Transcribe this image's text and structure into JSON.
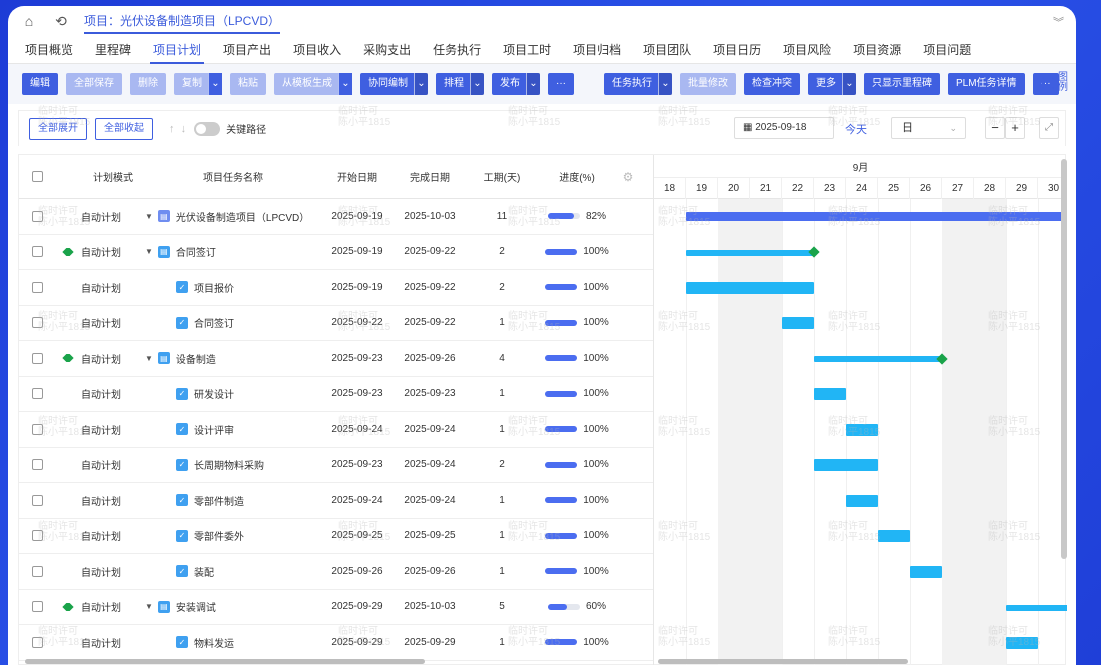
{
  "titlebar": {
    "home_icon": "home-icon",
    "back_icon": "history-icon",
    "title": "项目：光伏设备制造项目（LPCVD）"
  },
  "nav_tabs": [
    "项目概览",
    "里程碑",
    "项目计划",
    "项目产出",
    "项目收入",
    "采购支出",
    "任务执行",
    "项目工时",
    "项目归档",
    "项目团队",
    "项目日历",
    "项目风险",
    "项目资源",
    "项目问题"
  ],
  "nav_active": "项目计划",
  "toolbar": {
    "edit": "编辑",
    "save_all": "全部保存",
    "delete": "删除",
    "copy": "复制",
    "paste": "粘贴",
    "from_template": "从模板生成",
    "coedit": "协同编制",
    "schedule": "排程",
    "publish": "发布",
    "more_dots": "···",
    "task_exec": "任务执行",
    "batch_edit": "批量修改",
    "check_conflict": "检查冲突",
    "more": "更多",
    "only_milestone": "只显示里程碑",
    "plm_detail": "PLM任务详情",
    "more_dots2": "···",
    "legend": "图例"
  },
  "subbar": {
    "expand_all": "全部展开",
    "collapse_all": "全部收起",
    "critical_path": "关键路径",
    "date": "2025-09-18",
    "today": "今天",
    "scale": "日",
    "zoom_out": "−",
    "zoom_in": "+"
  },
  "table": {
    "headers": {
      "mode": "计划模式",
      "name": "项目任务名称",
      "start": "开始日期",
      "end": "完成日期",
      "duration": "工期(天)",
      "progress": "进度(%)"
    },
    "rows": [
      {
        "milestone": false,
        "mode": "自动计划",
        "level": 0,
        "expand": true,
        "type": "proj",
        "name": "光伏设备制造项目（LPCVD）",
        "start": "2025-09-19",
        "end": "2025-10-03",
        "duration": "11",
        "progress": "82%",
        "progress_value": 0.82
      },
      {
        "milestone": true,
        "mode": "自动计划",
        "level": 1,
        "expand": true,
        "type": "group",
        "name": "合同签订",
        "start": "2025-09-19",
        "end": "2025-09-22",
        "duration": "2",
        "progress": "100%",
        "progress_value": 1
      },
      {
        "milestone": false,
        "mode": "自动计划",
        "level": 2,
        "expand": false,
        "type": "task",
        "name": "项目报价",
        "start": "2025-09-19",
        "end": "2025-09-22",
        "duration": "2",
        "progress": "100%",
        "progress_value": 1
      },
      {
        "milestone": false,
        "mode": "自动计划",
        "level": 2,
        "expand": false,
        "type": "task",
        "name": "合同签订",
        "start": "2025-09-22",
        "end": "2025-09-22",
        "duration": "1",
        "progress": "100%",
        "progress_value": 1
      },
      {
        "milestone": true,
        "mode": "自动计划",
        "level": 1,
        "expand": true,
        "type": "group",
        "name": "设备制造",
        "start": "2025-09-23",
        "end": "2025-09-26",
        "duration": "4",
        "progress": "100%",
        "progress_value": 1
      },
      {
        "milestone": false,
        "mode": "自动计划",
        "level": 2,
        "expand": false,
        "type": "task",
        "name": "研发设计",
        "start": "2025-09-23",
        "end": "2025-09-23",
        "duration": "1",
        "progress": "100%",
        "progress_value": 1
      },
      {
        "milestone": false,
        "mode": "自动计划",
        "level": 2,
        "expand": false,
        "type": "task",
        "name": "设计评审",
        "start": "2025-09-24",
        "end": "2025-09-24",
        "duration": "1",
        "progress": "100%",
        "progress_value": 1
      },
      {
        "milestone": false,
        "mode": "自动计划",
        "level": 2,
        "expand": false,
        "type": "task",
        "name": "长周期物料采购",
        "start": "2025-09-23",
        "end": "2025-09-24",
        "duration": "2",
        "progress": "100%",
        "progress_value": 1
      },
      {
        "milestone": false,
        "mode": "自动计划",
        "level": 2,
        "expand": false,
        "type": "task",
        "name": "零部件制造",
        "start": "2025-09-24",
        "end": "2025-09-24",
        "duration": "1",
        "progress": "100%",
        "progress_value": 1
      },
      {
        "milestone": false,
        "mode": "自动计划",
        "level": 2,
        "expand": false,
        "type": "task",
        "name": "零部件委外",
        "start": "2025-09-25",
        "end": "2025-09-25",
        "duration": "1",
        "progress": "100%",
        "progress_value": 1
      },
      {
        "milestone": false,
        "mode": "自动计划",
        "level": 2,
        "expand": false,
        "type": "task",
        "name": "装配",
        "start": "2025-09-26",
        "end": "2025-09-26",
        "duration": "1",
        "progress": "100%",
        "progress_value": 1
      },
      {
        "milestone": true,
        "mode": "自动计划",
        "level": 1,
        "expand": true,
        "type": "group",
        "name": "安装调试",
        "start": "2025-09-29",
        "end": "2025-10-03",
        "duration": "5",
        "progress": "60%",
        "progress_value": 0.6
      },
      {
        "milestone": false,
        "mode": "自动计划",
        "level": 2,
        "expand": false,
        "type": "task",
        "name": "物料发运",
        "start": "2025-09-29",
        "end": "2025-09-29",
        "duration": "1",
        "progress": "100%",
        "progress_value": 1
      }
    ]
  },
  "gantt": {
    "month": "9月",
    "days": [
      "18",
      "19",
      "20",
      "21",
      "22",
      "23",
      "24",
      "25",
      "26",
      "27",
      "28",
      "29",
      "30"
    ],
    "weekends": [
      "20",
      "21",
      "27",
      "28"
    ],
    "milestone_color": "#1aa34a",
    "bar_color": "#21b5f5",
    "project_bar_color": "#4b6df0"
  },
  "watermark": [
    "临时许可",
    "陈小平1815"
  ]
}
